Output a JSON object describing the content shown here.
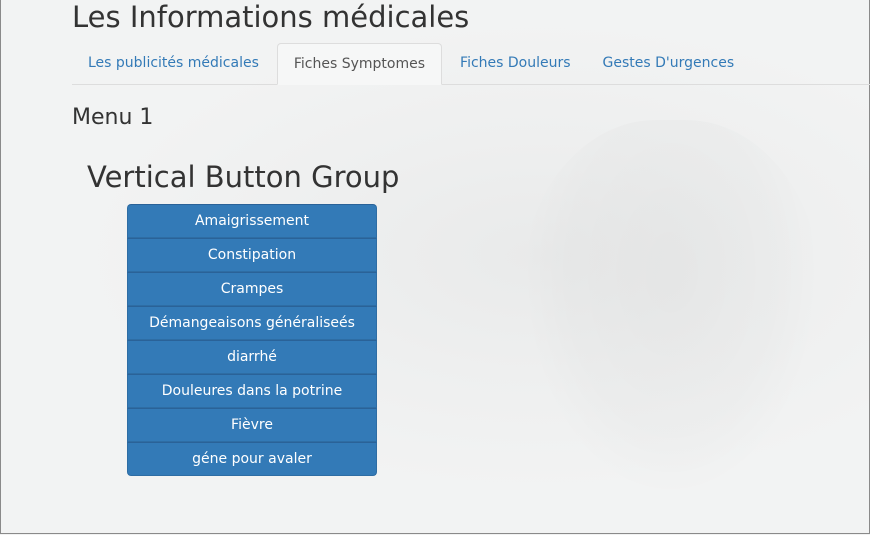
{
  "header": {
    "title": "Les Informations médicales"
  },
  "tabs": [
    {
      "label": "Les publicités médicales",
      "active": false
    },
    {
      "label": "Fiches Symptomes",
      "active": true
    },
    {
      "label": "Fiches Douleurs",
      "active": false
    },
    {
      "label": "Gestes D'urgences",
      "active": false
    }
  ],
  "main": {
    "menu_heading": "Menu 1",
    "group_heading": "Vertical Button Group",
    "buttons": [
      "Amaigrissement",
      "Constipation",
      "Crampes",
      "Démangeaisons généraliseés",
      "diarrhé",
      "Douleures dans la potrine",
      "Fièvre",
      "géne pour avaler"
    ]
  },
  "colors": {
    "accent": "#337ab7",
    "button_border": "#2e6da4",
    "background": "#f1f2f2"
  }
}
